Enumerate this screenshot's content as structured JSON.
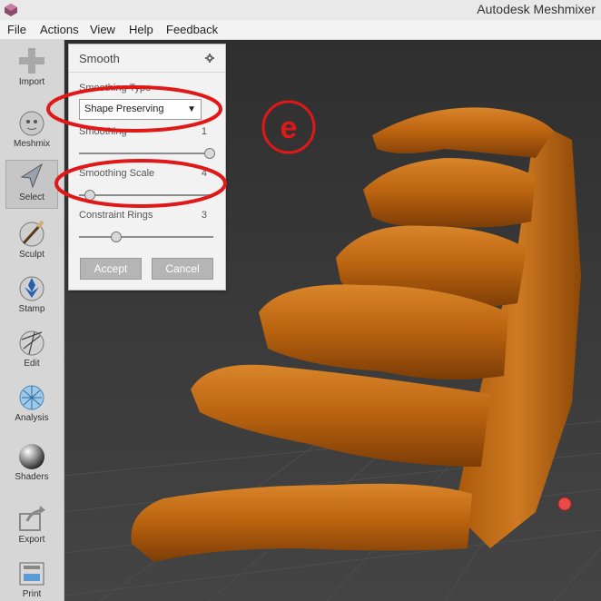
{
  "window": {
    "title": "Autodesk Meshmixer"
  },
  "menu": {
    "items": [
      "File",
      "Actions",
      "View",
      "Help",
      "Feedback"
    ]
  },
  "toolbar": {
    "tools": [
      {
        "label": "Import",
        "icon": "plus-icon"
      },
      {
        "label": "Meshmix",
        "icon": "bunny-icon"
      },
      {
        "label": "Select",
        "icon": "cursor-arrow-icon",
        "active": true
      },
      {
        "label": "Sculpt",
        "icon": "brush-icon"
      },
      {
        "label": "Stamp",
        "icon": "stamp-icon"
      },
      {
        "label": "Edit",
        "icon": "edit-sphere-icon"
      },
      {
        "label": "Analysis",
        "icon": "analysis-sphere-icon"
      },
      {
        "label": "Shaders",
        "icon": "shader-sphere-icon"
      },
      {
        "label": "Export",
        "icon": "export-icon"
      },
      {
        "label": "Print",
        "icon": "printer-icon"
      }
    ]
  },
  "panel": {
    "title": "Smooth",
    "smoothing_type": {
      "label": "Smoothing Type",
      "value": "Shape Preserving"
    },
    "smoothing": {
      "label": "Smoothing",
      "value": "1",
      "level": 1.0
    },
    "smoothing_scale": {
      "label": "Smoothing Scale",
      "value": "4",
      "level": 0.04
    },
    "constraint_rings": {
      "label": "Constraint Rings",
      "value": "3",
      "level": 0.25
    },
    "accept_label": "Accept",
    "cancel_label": "Cancel"
  },
  "annotation": {
    "letter": "e",
    "color": "#dd1111"
  },
  "colors": {
    "mesh": "#b8620f",
    "mesh_light": "#d9852a",
    "mesh_dark": "#7d3d07",
    "annotation_red": "#e01818"
  }
}
